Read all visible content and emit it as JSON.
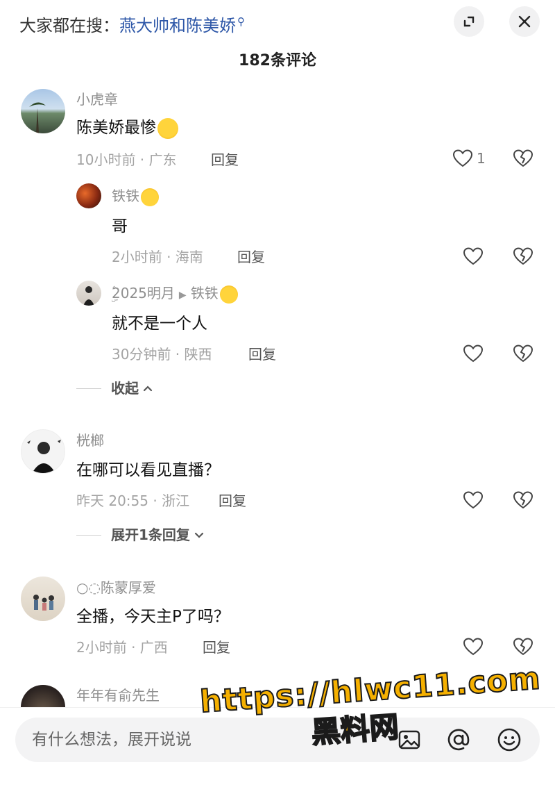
{
  "header": {
    "search_prefix": "大家都在搜：",
    "search_keyword": "燕大帅和陈美娇",
    "comment_count": "182条评论"
  },
  "comments": [
    {
      "user": "小虎章",
      "text": "陈美娇最惨",
      "meta": "10小时前 · 广东",
      "reply_label": "回复",
      "likes": "1",
      "replies": [
        {
          "user": "铁铁",
          "text": "哥",
          "meta": "2小时前 · 海南",
          "reply_label": "回复"
        },
        {
          "user": "ۣ۫2025明月",
          "reply_to": "铁铁",
          "text": "就不是一个人",
          "meta": "30分钟前 · 陕西",
          "reply_label": "回复"
        }
      ],
      "fold_label": "收起"
    },
    {
      "user": "桄榔",
      "text": "在哪可以看见直播？",
      "meta": "昨天 20:55 · 浙江",
      "reply_label": "回复",
      "expand_label": "展开1条回复"
    },
    {
      "user": "○◌陈蒙厚爱",
      "text": "全播，今天主P了吗？",
      "meta": "2小时前 · 广西",
      "reply_label": "回复"
    },
    {
      "user": "年年有俞先生"
    }
  ],
  "input": {
    "placeholder": "有什么想法，展开说说"
  },
  "watermark": {
    "url": "https://hlwc11.com",
    "name": "黑料网"
  },
  "icons": [
    "search-icon",
    "expand-icon",
    "close-icon",
    "heart-icon",
    "broken-heart-icon",
    "chevron-up-icon",
    "chevron-down-icon",
    "image-icon",
    "at-icon",
    "emoji-icon"
  ],
  "colors": {
    "link": "#2f58a8",
    "watermark": "#f5b000"
  }
}
